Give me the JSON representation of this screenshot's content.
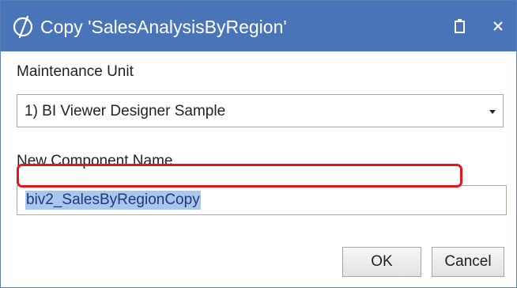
{
  "dialog": {
    "title": "Copy 'SalesAnalysisByRegion'",
    "logo_icon": "onestream-logo-icon",
    "controls": {
      "maximize_icon": "maximize-icon",
      "close_icon": "close-icon"
    },
    "colors": {
      "titlebar": "#4a74b8",
      "highlight": "#e0181b",
      "selection": "#a9c6ee"
    }
  },
  "maintenance_unit": {
    "label": "Maintenance Unit",
    "selected": "1) BI Viewer Designer Sample"
  },
  "component_name": {
    "label": "New Component Name",
    "value": "biv2_SalesByRegionCopy"
  },
  "buttons": {
    "ok": "OK",
    "cancel": "Cancel"
  }
}
